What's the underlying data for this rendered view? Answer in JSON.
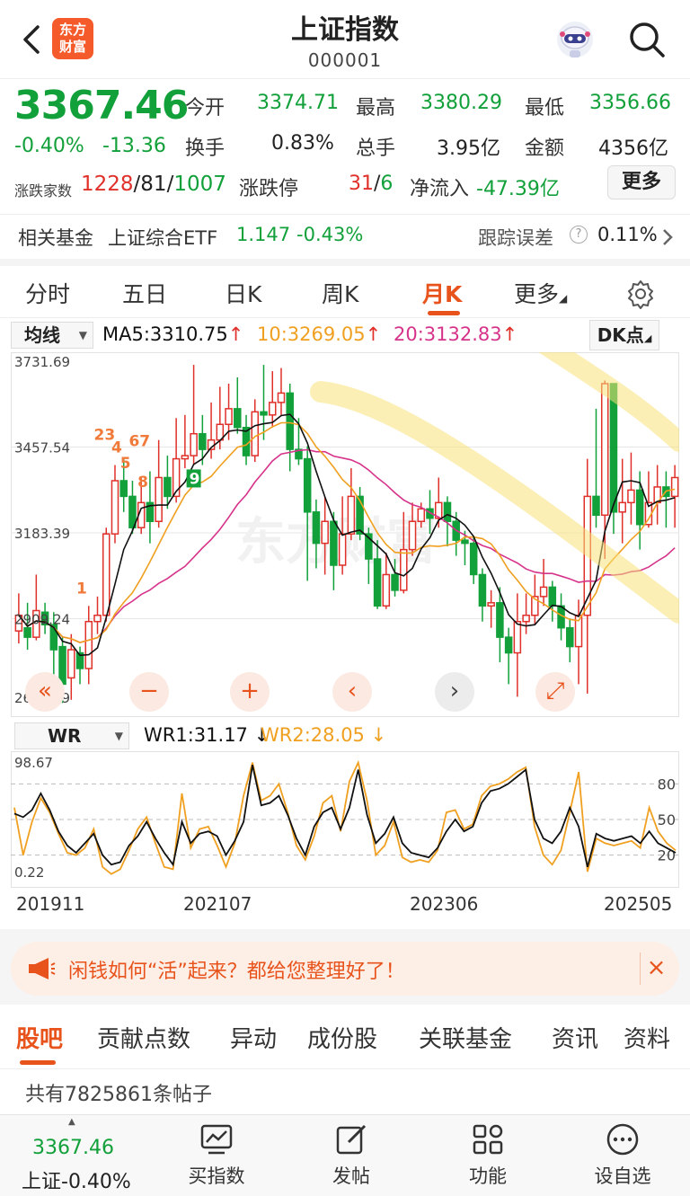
{
  "header": {
    "title": "上证指数",
    "code": "000001",
    "logo_text_1": "东方",
    "logo_text_2": "财富"
  },
  "quote": {
    "price": "3367.46",
    "change_pct": "-0.40%",
    "change": "-13.36",
    "open_label": "今开",
    "open": "3374.71",
    "high_label": "最高",
    "high": "3380.29",
    "low_label": "最低",
    "low": "3356.66",
    "turnover_label": "换手",
    "turnover": "0.83%",
    "volume_label": "总手",
    "volume": "3.95亿",
    "amount_label": "金额",
    "amount": "4356亿",
    "breadth_label": "涨跌家数",
    "up_count": "1228",
    "flat_count": "81",
    "down_count": "1007",
    "limit_label": "涨跌停",
    "limit_up": "31",
    "limit_down": "6",
    "netflow_label": "净流入",
    "netflow": "-47.39亿",
    "more_label": "更多"
  },
  "fund": {
    "label": "相关基金",
    "name": "上证综合ETF",
    "price": "1.147",
    "change": "-0.43%",
    "error_label": "跟踪误差",
    "error": "0.11%"
  },
  "ktabs": [
    "分时",
    "五日",
    "日K",
    "周K",
    "月K",
    "更多"
  ],
  "active_ktab": "月K",
  "ma": {
    "select": "均线",
    "ma5": "MA5:3310.75",
    "ma10": "10:3269.05",
    "ma20": "20:3132.83",
    "dk": "DK点"
  },
  "chart_data": [
    {
      "type": "candlestick",
      "y_ticks": [
        "3731.69",
        "3457.54",
        "3183.39",
        "2909.24",
        "2635.09"
      ],
      "ylim": [
        2635.09,
        3731.69
      ],
      "colors": {
        "up": "#e0302a",
        "down": "#12a03a",
        "ma5": "#111111",
        "ma10": "#f0a020",
        "ma20": "#d6338a"
      },
      "signals": [
        "1",
        "23",
        "4",
        "5",
        "67",
        "8",
        "9"
      ],
      "candles": [
        [
          2870,
          2920,
          2990,
          2830
        ],
        [
          2880,
          2850,
          2960,
          2810
        ],
        [
          2850,
          2935,
          3050,
          2840
        ],
        [
          2930,
          2890,
          2960,
          2860
        ],
        [
          2890,
          2810,
          2930,
          2700
        ],
        [
          2820,
          2700,
          2850,
          2640
        ],
        [
          2720,
          2810,
          2860,
          2650
        ],
        [
          2800,
          2750,
          2820,
          2700
        ],
        [
          2750,
          2900,
          2950,
          2700
        ],
        [
          2900,
          2920,
          2980,
          2860
        ],
        [
          2920,
          3180,
          3200,
          2900
        ],
        [
          3180,
          3350,
          3400,
          3150
        ],
        [
          3350,
          3300,
          3420,
          3250
        ],
        [
          3300,
          3200,
          3350,
          3180
        ],
        [
          3200,
          3280,
          3360,
          3180
        ],
        [
          3280,
          3220,
          3380,
          3150
        ],
        [
          3220,
          3360,
          3480,
          3200
        ],
        [
          3360,
          3300,
          3430,
          3260
        ],
        [
          3300,
          3420,
          3550,
          3280
        ],
        [
          3420,
          3430,
          3560,
          3390
        ],
        [
          3430,
          3500,
          3720,
          3400
        ],
        [
          3500,
          3450,
          3560,
          3400
        ],
        [
          3450,
          3480,
          3600,
          3420
        ],
        [
          3480,
          3530,
          3650,
          3450
        ],
        [
          3530,
          3580,
          3660,
          3480
        ],
        [
          3580,
          3520,
          3680,
          3500
        ],
        [
          3520,
          3430,
          3560,
          3400
        ],
        [
          3430,
          3570,
          3610,
          3410
        ],
        [
          3570,
          3560,
          3720,
          3480
        ],
        [
          3560,
          3600,
          3700,
          3520
        ],
        [
          3600,
          3630,
          3710,
          3560
        ],
        [
          3630,
          3450,
          3660,
          3380
        ],
        [
          3450,
          3420,
          3550,
          3400
        ],
        [
          3420,
          3250,
          3460,
          3030
        ],
        [
          3250,
          3150,
          3290,
          3070
        ],
        [
          3150,
          3220,
          3300,
          3050
        ],
        [
          3220,
          3080,
          3250,
          3000
        ],
        [
          3080,
          3180,
          3300,
          3050
        ],
        [
          3180,
          3300,
          3390,
          3160
        ],
        [
          3300,
          3180,
          3330,
          3160
        ],
        [
          3180,
          3100,
          3200,
          3020
        ],
        [
          3100,
          2950,
          3160,
          2940
        ],
        [
          2950,
          3050,
          3120,
          2940
        ],
        [
          3050,
          3000,
          3100,
          2980
        ],
        [
          3000,
          3130,
          3250,
          2990
        ],
        [
          3130,
          3220,
          3280,
          3110
        ],
        [
          3220,
          3260,
          3280,
          3200
        ],
        [
          3260,
          3230,
          3320,
          3180
        ],
        [
          3230,
          3280,
          3360,
          3200
        ],
        [
          3280,
          3220,
          3300,
          3140
        ],
        [
          3220,
          3160,
          3250,
          3110
        ],
        [
          3160,
          3150,
          3190,
          3080
        ],
        [
          3150,
          3050,
          3170,
          3020
        ],
        [
          3050,
          2950,
          3070,
          2900
        ],
        [
          2950,
          2960,
          3000,
          2880
        ],
        [
          2960,
          2850,
          3010,
          2770
        ],
        [
          2850,
          2800,
          2880,
          2700
        ],
        [
          2800,
          2900,
          2990,
          2660
        ],
        [
          2900,
          2920,
          2990,
          2860
        ],
        [
          2920,
          2980,
          3050,
          2890
        ],
        [
          2980,
          3010,
          3100,
          2950
        ],
        [
          3010,
          2950,
          3030,
          2900
        ],
        [
          2950,
          2880,
          2990,
          2840
        ],
        [
          2880,
          2820,
          2910,
          2770
        ],
        [
          2820,
          2920,
          2970,
          2700
        ],
        [
          2920,
          3300,
          3420,
          2670
        ],
        [
          3300,
          3240,
          3580,
          3200
        ],
        [
          3240,
          3660,
          3670,
          3100
        ],
        [
          3660,
          3250,
          3480,
          3180
        ],
        [
          3250,
          3280,
          3420,
          3150
        ],
        [
          3280,
          3320,
          3440,
          3210
        ],
        [
          3320,
          3210,
          3380,
          3130
        ],
        [
          3210,
          3280,
          3380,
          3200
        ],
        [
          3280,
          3330,
          3400,
          3210
        ],
        [
          3330,
          3300,
          3380,
          3200
        ],
        [
          3300,
          3360,
          3400,
          3200
        ]
      ]
    },
    {
      "type": "line",
      "name": "WR",
      "select": "WR",
      "labels": {
        "wr1": "WR1:31.17",
        "wr2": "WR2:28.05"
      },
      "y_ticks_left": [
        "98.67",
        "0.22"
      ],
      "y_ticks_right": [
        "80",
        "50",
        "20"
      ],
      "ylim": [
        0,
        100
      ],
      "colors": {
        "wr1": "#111111",
        "wr2": "#f0a020"
      },
      "series": [
        {
          "name": "WR1",
          "values": [
            55,
            52,
            58,
            72,
            58,
            40,
            28,
            22,
            30,
            38,
            20,
            12,
            14,
            28,
            36,
            48,
            34,
            22,
            12,
            48,
            30,
            38,
            40,
            36,
            20,
            32,
            48,
            96,
            62,
            64,
            70,
            54,
            34,
            20,
            44,
            56,
            60,
            42,
            60,
            92,
            54,
            30,
            38,
            52,
            30,
            22,
            20,
            18,
            26,
            40,
            50,
            40,
            44,
            64,
            74,
            76,
            80,
            86,
            92,
            50,
            34,
            30,
            40,
            60,
            44,
            10,
            38,
            34,
            32,
            34,
            36,
            30,
            40,
            30,
            26,
            22
          ]
        },
        {
          "name": "WR2",
          "values": [
            60,
            20,
            48,
            68,
            56,
            38,
            22,
            20,
            26,
            42,
            10,
            4,
            8,
            24,
            42,
            52,
            30,
            10,
            8,
            72,
            26,
            42,
            44,
            28,
            10,
            30,
            70,
            98,
            66,
            70,
            80,
            56,
            28,
            16,
            36,
            64,
            70,
            40,
            82,
            98,
            66,
            20,
            28,
            48,
            18,
            14,
            16,
            14,
            24,
            56,
            58,
            42,
            46,
            70,
            78,
            80,
            84,
            90,
            94,
            44,
            20,
            12,
            24,
            56,
            90,
            6,
            34,
            30,
            28,
            30,
            32,
            26,
            60,
            40,
            30,
            24
          ]
        }
      ],
      "x_ticks": [
        "201911",
        "202107",
        "202306",
        "202505"
      ]
    }
  ],
  "banner": {
    "text": "闲钱如何“活”起来？都给您整理好了！",
    "close": "×"
  },
  "btabs": [
    "股吧",
    "贡献点数",
    "异动",
    "成份股",
    "关联基金",
    "资讯",
    "资料"
  ],
  "posts": "共有7825861条帖子",
  "tabbar": {
    "price": "3367.46",
    "name_change": "上证-0.40%",
    "items": [
      "买指数",
      "发帖",
      "功能",
      "设自选"
    ]
  }
}
